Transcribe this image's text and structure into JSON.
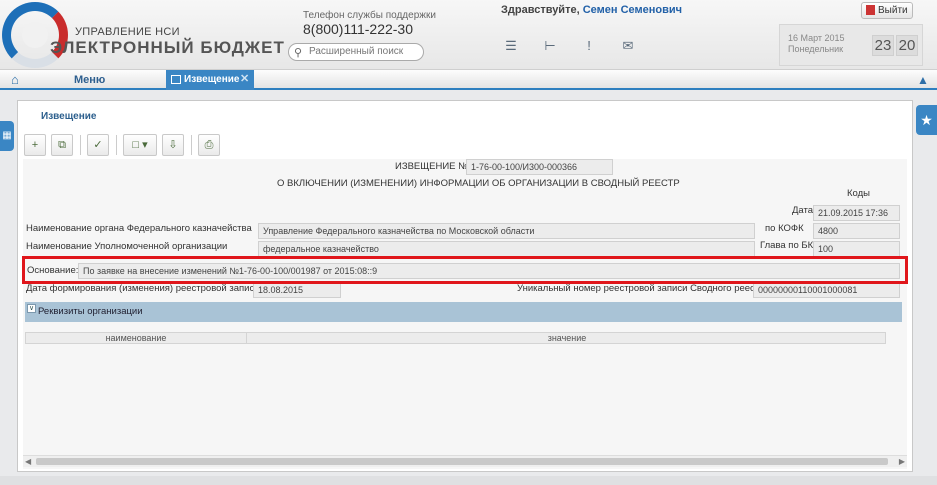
{
  "header": {
    "logo_sub": "УПРАВЛЕНИЕ НСИ",
    "logo_main": "ЭЛЕКТРОННЫЙ БЮДЖЕТ",
    "support_label": "Телефон службы поддержки",
    "support_phone": "8(800)111-222-30",
    "search_placeholder": "Расширенный поиск",
    "greeting": "Здравствуйте,",
    "user_name": "Семен Семенович",
    "logout_label": "Выйти",
    "date_line1": "16 Март 2015",
    "date_line2": "Понедельник",
    "time_hours": "23",
    "time_minutes": "20",
    "icons": [
      "list-icon",
      "hierarchy-icon",
      "alert-icon",
      "mail-icon"
    ]
  },
  "nav": {
    "menu_label": "Меню",
    "active_tab": "Извещение"
  },
  "panel": {
    "title": "Извещение",
    "notice_label": "ИЗВЕЩЕНИЕ №",
    "notice_number": "1-76-00-100/И300-000366",
    "subtitle": "О ВКЛЮЧЕНИИ (ИЗМЕНЕНИИ) ИНФОРМАЦИИ ОБ ОРГАНИЗАЦИИ В СВОДНЫЙ РЕЕСТР",
    "codes_label": "Коды",
    "date_label": "Дата",
    "date_value": "21.09.2015 17:36",
    "kofk_label": "по КОФК",
    "kofk_value": "4800",
    "glava_label": "Глава по БК",
    "glava_value": "100",
    "fk_org_label": "Наименование органа Федерального казначейства",
    "fk_org_value": "Управление Федерального казначейства по Московской области",
    "auth_org_label": "Наименование Уполномоченной организации",
    "auth_org_value": "федеральное казначейство",
    "basis_label": "Основание:",
    "basis_value": "По заявке на внесение изменений №1-76-00-100/001987 от 2015:08::9",
    "formation_date_label": "Дата формирования (изменения) реестровой записи",
    "formation_date_value": "18.08.2015",
    "registry_label": "Уникальный номер реестровой записи Сводного реестра",
    "registry_value": "00000000110001000081",
    "section_label": "Реквизиты организации",
    "col_name": "наименование",
    "col_value": "значение"
  }
}
